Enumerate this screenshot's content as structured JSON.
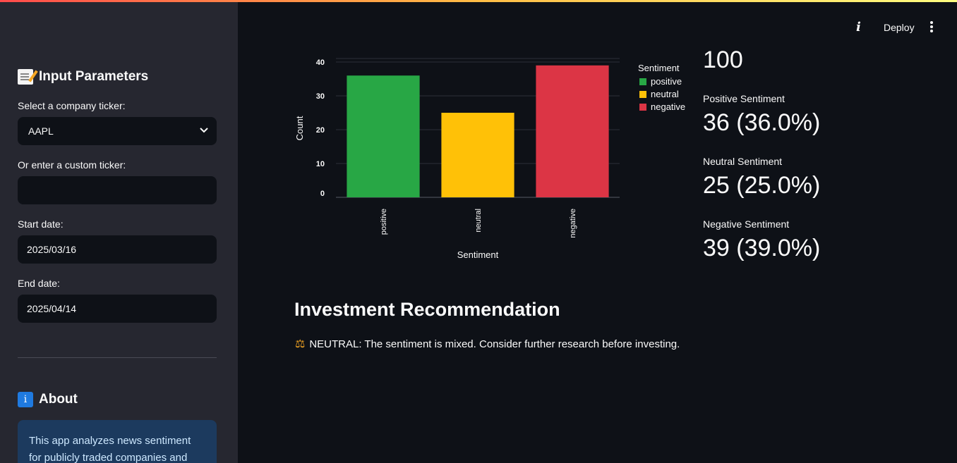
{
  "sidebar": {
    "input_heading": "Input Parameters",
    "ticker_label": "Select a company ticker:",
    "ticker_value": "AAPL",
    "custom_label": "Or enter a custom ticker:",
    "custom_value": "",
    "start_label": "Start date:",
    "start_value": "2025/03/16",
    "end_label": "End date:",
    "end_value": "2025/04/14",
    "about_heading": "About",
    "about_text": "This app analyzes news sentiment for publicly traded companies and"
  },
  "header": {
    "deploy_label": "Deploy"
  },
  "chart_data": {
    "type": "bar",
    "categories": [
      "positive",
      "neutral",
      "negative"
    ],
    "values": [
      36,
      25,
      39
    ],
    "colors": [
      "#28a745",
      "#ffc107",
      "#dc3545"
    ],
    "xlabel": "Sentiment",
    "ylabel": "Count",
    "ylim": [
      0,
      40
    ],
    "yticks": [
      0,
      10,
      20,
      30,
      40
    ],
    "legend_title": "Sentiment",
    "legend": [
      "positive",
      "neutral",
      "negative"
    ],
    "legend_placement": "right",
    "grid": true
  },
  "metrics": {
    "total_value": "100",
    "positive_label": "Positive Sentiment",
    "positive_value": "36 (36.0%)",
    "neutral_label": "Neutral Sentiment",
    "neutral_value": "25 (25.0%)",
    "negative_label": "Negative Sentiment",
    "negative_value": "39 (39.0%)"
  },
  "recommendation": {
    "title": "Investment Recommendation",
    "text": "NEUTRAL: The sentiment is mixed. Consider further research before investing.",
    "icon": "balance-scale-icon"
  }
}
